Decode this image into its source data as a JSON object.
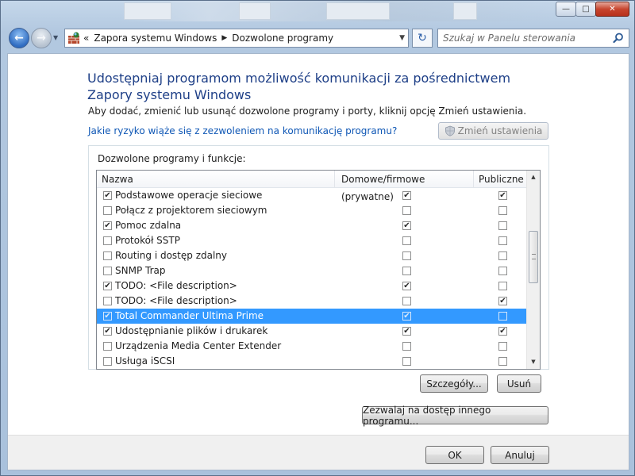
{
  "window": {
    "minimize_glyph": "—",
    "maximize_glyph": "□",
    "close_glyph": "✕"
  },
  "nav": {
    "back_glyph": "←",
    "forward_glyph": "→",
    "address": {
      "prefix": "«",
      "crumbs": [
        "Zapora systemu Windows",
        "Dozwolone programy"
      ],
      "separator": "▶"
    },
    "refresh_glyph": "↻",
    "search": {
      "placeholder": "Szukaj w Panelu sterowania"
    }
  },
  "page": {
    "heading": "Udostępniaj programom możliwość komunikacji za pośrednictwem Zapory systemu Windows",
    "subtext": "Aby dodać, zmienić lub usunąć dozwolone programy i porty, kliknij opcję Zmień ustawienia.",
    "risk_link": "Jakie ryzyko wiąże się z zezwoleniem na komunikację programu?",
    "change_settings_label": "Zmień ustawienia",
    "group_label": "Dozwolone programy i funkcje:",
    "columns": {
      "name": "Nazwa",
      "home": "Domowe/firmowe (prywatne)",
      "public": "Publiczne"
    },
    "programs": [
      {
        "name": "Podstawowe operacje sieciowe",
        "enabled": true,
        "home": true,
        "public": true
      },
      {
        "name": "Połącz z projektorem sieciowym",
        "enabled": false,
        "home": false,
        "public": false
      },
      {
        "name": "Pomoc zdalna",
        "enabled": true,
        "home": true,
        "public": false
      },
      {
        "name": "Protokół SSTP",
        "enabled": false,
        "home": false,
        "public": false
      },
      {
        "name": "Routing i dostęp zdalny",
        "enabled": false,
        "home": false,
        "public": false
      },
      {
        "name": "SNMP Trap",
        "enabled": false,
        "home": false,
        "public": false
      },
      {
        "name": "TODO: <File description>",
        "enabled": true,
        "home": true,
        "public": false
      },
      {
        "name": "TODO: <File description>",
        "enabled": false,
        "home": false,
        "public": true
      },
      {
        "name": "Total Commander Ultima Prime",
        "enabled": true,
        "home": true,
        "public": false,
        "selected": true
      },
      {
        "name": "Udostępnianie plików i drukarek",
        "enabled": true,
        "home": true,
        "public": true
      },
      {
        "name": "Urządzenia Media Center Extender",
        "enabled": false,
        "home": false,
        "public": false
      },
      {
        "name": "Usługa iSCSI",
        "enabled": false,
        "home": false,
        "public": false
      }
    ],
    "details_label": "Szczegóły...",
    "remove_label": "Usuń",
    "allow_other_label": "Zezwalaj na dostęp innego programu...",
    "ok_label": "OK",
    "cancel_label": "Anuluj"
  },
  "colors": {
    "heading": "#1e3f87",
    "link": "#0f57b5",
    "selection": "#3399ff"
  }
}
